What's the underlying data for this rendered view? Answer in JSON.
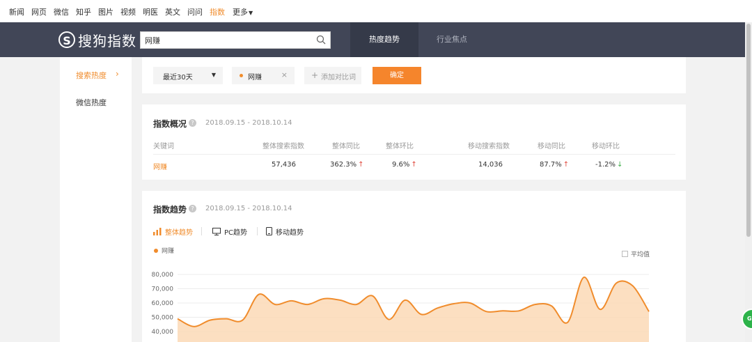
{
  "topnav": {
    "items": [
      "新闻",
      "网页",
      "微信",
      "知乎",
      "图片",
      "视频",
      "明医",
      "英文",
      "问问",
      "指数",
      "更多"
    ],
    "active_index": 9
  },
  "header": {
    "logo_mark": "S",
    "logo_text": "搜狗指数",
    "search_value": "网赚",
    "tabs": [
      "热度趋势",
      "行业焦点"
    ],
    "active_tab": 0
  },
  "sidebar": {
    "items": [
      "搜索热度",
      "微信热度"
    ],
    "active_index": 0,
    "active_arrow": "›"
  },
  "filter": {
    "range_label": "最近30天",
    "range_arrow": "▼",
    "keyword_tag": "网赚",
    "remove_glyph": "×",
    "add_plus": "+",
    "add_compare": "添加对比词",
    "confirm": "确定"
  },
  "overview": {
    "title": "指数概况",
    "help": "?",
    "date_range": "2018.09.15 - 2018.10.14",
    "headers": [
      "关键词",
      "整体搜索指数",
      "整体同比",
      "整体环比",
      "移动搜索指数",
      "移动同比",
      "移动环比"
    ],
    "row": {
      "keyword": "网赚",
      "total_index": "57,436",
      "total_yoy": "362.3%",
      "total_yoy_dir": "↑",
      "total_mom": "9.6%",
      "total_mom_dir": "↑",
      "mobile_index": "14,036",
      "mobile_yoy": "87.7%",
      "mobile_yoy_dir": "↑",
      "mobile_mom": "-1.2%",
      "mobile_mom_dir": "↓"
    }
  },
  "trend": {
    "title": "指数趋势",
    "help": "?",
    "date_range": "2018.09.15 - 2018.10.14",
    "tabs": [
      "整体趋势",
      "PC趋势",
      "移动趋势"
    ],
    "active_tab": 0,
    "legend": "网赚",
    "avg_label": "平均值"
  },
  "chart_data": {
    "type": "area",
    "series": [
      {
        "name": "网赚",
        "color": "#f08c2c",
        "values": [
          49000,
          43500,
          48000,
          49000,
          48000,
          66000,
          59000,
          61500,
          59000,
          63000,
          62000,
          59000,
          65000,
          48500,
          62000,
          52000,
          56500,
          59500,
          60000,
          54000,
          54500,
          54500,
          59000,
          58000,
          46500,
          78000,
          55500,
          74000,
          72000,
          54000
        ]
      }
    ],
    "y_ticks": [
      "80,000",
      "70,000",
      "60,000",
      "50,000",
      "40,000"
    ],
    "ylim": [
      30000,
      80000
    ],
    "grid": true,
    "colors": {
      "line": "#f08c2c",
      "fill": "#fbd9b6"
    }
  },
  "badge": {
    "text": "GO"
  }
}
